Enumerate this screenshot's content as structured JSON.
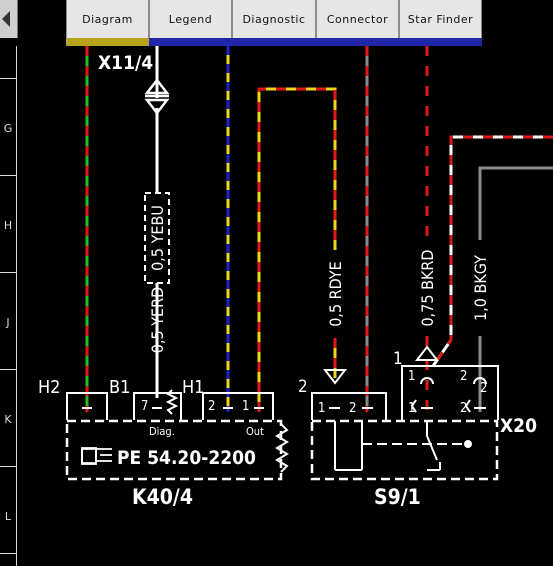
{
  "tabs": [
    {
      "label": "Diagram",
      "active": true
    },
    {
      "label": "Legend",
      "active": false
    },
    {
      "label": "Diagnostic",
      "active": false
    },
    {
      "label": "Connector",
      "active": false
    },
    {
      "label": "Star Finder",
      "active": false
    }
  ],
  "ruler": {
    "rows": [
      "G",
      "H",
      "J",
      "K",
      "L"
    ]
  },
  "schematic": {
    "ground_point": "X11/4",
    "wires": [
      {
        "label": "0,5 YEBU",
        "boxed": true
      },
      {
        "label": "0,5 YERD"
      },
      {
        "label": "0,5 RDYE"
      },
      {
        "label": "0,75 BKRD"
      },
      {
        "label": "1,0 BKGY"
      }
    ],
    "left_component": {
      "designator": "K40/4",
      "reference": "PE 54.20-2200",
      "connectors": [
        "H2",
        "B1",
        "H1"
      ],
      "pins": [
        "7",
        "2",
        "1"
      ],
      "pin_captions": [
        "Diag.",
        "Out"
      ]
    },
    "right_component": {
      "designator": "S9/1",
      "connector": "X20",
      "pins": [
        "1",
        "2",
        "1",
        "2"
      ],
      "terminal_labels": [
        "2",
        "1",
        "1",
        "2",
        "2"
      ]
    }
  }
}
